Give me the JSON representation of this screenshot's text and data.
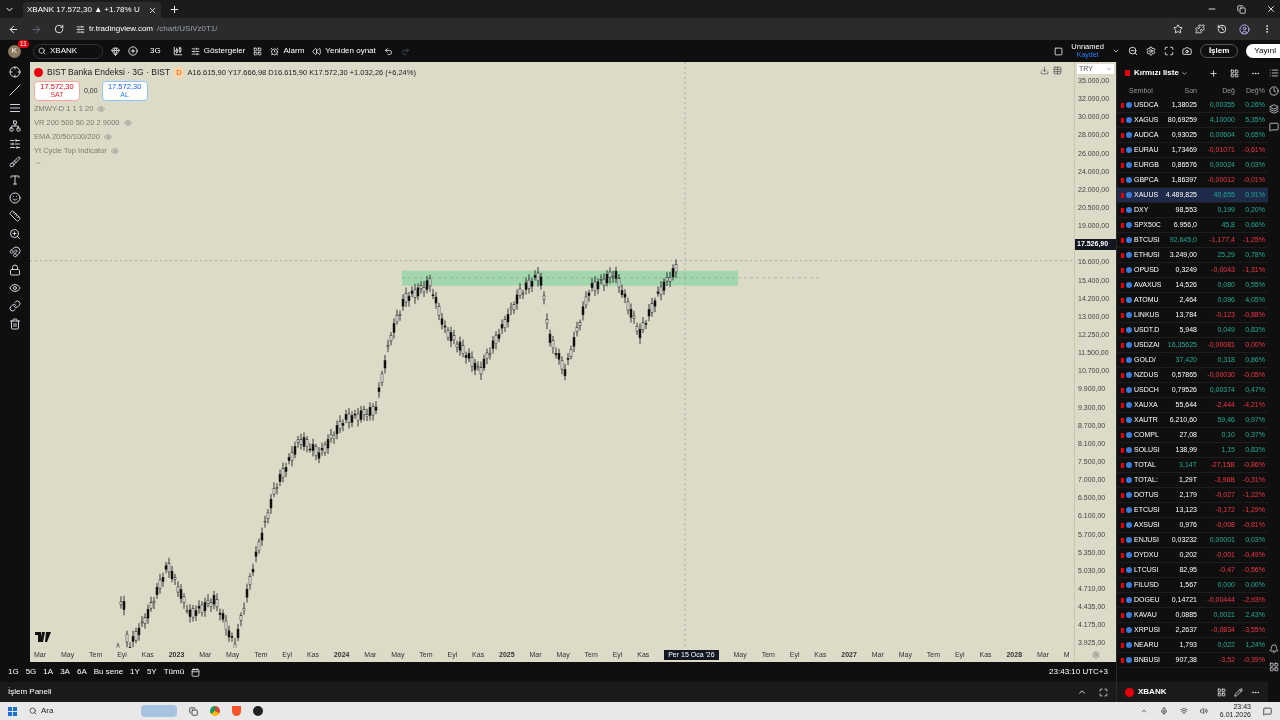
{
  "browser": {
    "tab_title": "XBANK 17.572,30 ▲ +1.78% U",
    "url_domain": "tr.tradingview.com",
    "url_path": "/chart/USiVz0T1/"
  },
  "toolbar": {
    "avatar": "K",
    "badge": "11",
    "symbol": "XBANK",
    "interval": "3G",
    "indicators": "Göstergeler",
    "alarm": "Alarm",
    "replay": "Yeniden oynat",
    "layout_name": "Unnamed",
    "save": "Kaydet",
    "trade": "İşlem",
    "publish": "Yayınl"
  },
  "legend": {
    "title": "BIST Banka Endeksi · 3G · BIST",
    "badge": "D",
    "ohlc": "A16.615,90 Y17.666,98 D16.615,90 K17.572,30 +1.032,26 (+6,24%)",
    "sell_price": "17.572,30",
    "sell_label": "SAT",
    "spread": "0,00",
    "buy_price": "17.572,30",
    "buy_label": "AL",
    "indicators": [
      "ZMWY-D 1 1 1 20",
      "VR 200 500 50 20 2 9000",
      "EMA 20/50/100/200",
      "Yt Cycle Top Indicator"
    ]
  },
  "price_axis": {
    "currency": "TRY",
    "labels": [
      {
        "text": "35.000,00",
        "kind": "tick"
      },
      {
        "text": "32.000,00",
        "kind": "tick"
      },
      {
        "text": "30.000,00",
        "kind": "tick"
      },
      {
        "text": "28.000,00",
        "kind": "tick"
      },
      {
        "text": "26.000,00",
        "kind": "tick"
      },
      {
        "text": "24.000,00",
        "kind": "tick"
      },
      {
        "text": "22.000,00",
        "kind": "tick"
      },
      {
        "text": "20.500,00",
        "kind": "tick"
      },
      {
        "text": "19.000,00",
        "kind": "tick"
      },
      {
        "text": "17.526,90",
        "kind": "crosshair"
      },
      {
        "text": "16.600,00",
        "kind": "tick"
      },
      {
        "text": "15.400,00",
        "kind": "tick"
      },
      {
        "text": "14.200,00",
        "kind": "tick"
      },
      {
        "text": "13.000,00",
        "kind": "tick"
      },
      {
        "text": "12.250,00",
        "kind": "tick"
      },
      {
        "text": "11.500,00",
        "kind": "tick"
      },
      {
        "text": "10.700,00",
        "kind": "tick"
      },
      {
        "text": "9.900,00",
        "kind": "tick"
      },
      {
        "text": "9.300,00",
        "kind": "tick"
      },
      {
        "text": "8.700,00",
        "kind": "tick"
      },
      {
        "text": "8.100,00",
        "kind": "tick"
      },
      {
        "text": "7.500,00",
        "kind": "tick"
      },
      {
        "text": "7.000,00",
        "kind": "tick"
      },
      {
        "text": "6.500,00",
        "kind": "tick"
      },
      {
        "text": "6.100,00",
        "kind": "tick"
      },
      {
        "text": "5.700,00",
        "kind": "tick"
      },
      {
        "text": "5.350,00",
        "kind": "tick"
      },
      {
        "text": "5.030,00",
        "kind": "tick"
      },
      {
        "text": "4.710,00",
        "kind": "tick"
      },
      {
        "text": "4.435,00",
        "kind": "tick"
      },
      {
        "text": "4.175,00",
        "kind": "tick"
      },
      {
        "text": "3.925,00",
        "kind": "tick"
      }
    ]
  },
  "time_axis": [
    {
      "text": "Mar",
      "kind": "tick"
    },
    {
      "text": "May",
      "kind": "tick"
    },
    {
      "text": "Tem",
      "kind": "tick"
    },
    {
      "text": "Eyl",
      "kind": "tick"
    },
    {
      "text": "Kas",
      "kind": "tick"
    },
    {
      "text": "2023",
      "kind": "year"
    },
    {
      "text": "Mar",
      "kind": "tick"
    },
    {
      "text": "May",
      "kind": "tick"
    },
    {
      "text": "Tem",
      "kind": "tick"
    },
    {
      "text": "Eyl",
      "kind": "tick"
    },
    {
      "text": "Kas",
      "kind": "tick"
    },
    {
      "text": "2024",
      "kind": "year"
    },
    {
      "text": "Mar",
      "kind": "tick"
    },
    {
      "text": "May",
      "kind": "tick"
    },
    {
      "text": "Tem",
      "kind": "tick"
    },
    {
      "text": "Eyl",
      "kind": "tick"
    },
    {
      "text": "Kas",
      "kind": "tick"
    },
    {
      "text": "2025",
      "kind": "year"
    },
    {
      "text": "Mar",
      "kind": "tick"
    },
    {
      "text": "May",
      "kind": "tick"
    },
    {
      "text": "Tem",
      "kind": "tick"
    },
    {
      "text": "Eyl",
      "kind": "tick"
    },
    {
      "text": "Kas",
      "kind": "tick"
    },
    {
      "text": "Per 15 Oca '26",
      "kind": "crosshair"
    },
    {
      "text": "May",
      "kind": "tick"
    },
    {
      "text": "Tem",
      "kind": "tick"
    },
    {
      "text": "Eyl",
      "kind": "tick"
    },
    {
      "text": "Kas",
      "kind": "tick"
    },
    {
      "text": "2027",
      "kind": "year"
    },
    {
      "text": "Mar",
      "kind": "tick"
    },
    {
      "text": "May",
      "kind": "tick"
    },
    {
      "text": "Tem",
      "kind": "tick"
    },
    {
      "text": "Eyl",
      "kind": "tick"
    },
    {
      "text": "Kas",
      "kind": "tick"
    },
    {
      "text": "2028",
      "kind": "year"
    },
    {
      "text": "Mar",
      "kind": "tick"
    },
    {
      "text": "M",
      "kind": "tick"
    }
  ],
  "ranges": [
    "1G",
    "5G",
    "1A",
    "3A",
    "6A",
    "Bu sene",
    "1Y",
    "5Y",
    "Tümü"
  ],
  "clock": "23:43:10 UTC+3",
  "bottom_panel": "İşlem Paneli",
  "watchlist": {
    "title": "Kırmızı liste",
    "columns": [
      "Sembol",
      "Son",
      "Değ",
      "Değ%"
    ],
    "footer_symbol": "XBANK",
    "rows": [
      {
        "symbol": "USDCA",
        "last": "1,38025",
        "change": "0,00355",
        "change_pct": "0,26%",
        "up": true,
        "last_up": false,
        "selected": false
      },
      {
        "symbol": "XAGUS",
        "last": "80,69259",
        "change": "4,10000",
        "change_pct": "5,35%",
        "up": true,
        "last_up": false,
        "selected": false
      },
      {
        "symbol": "AUDCA",
        "last": "0,93025",
        "change": "0,00604",
        "change_pct": "0,65%",
        "up": true,
        "last_up": false,
        "selected": false
      },
      {
        "symbol": "EURAU",
        "last": "1,73469",
        "change": "-0,01071",
        "change_pct": "-0,61%",
        "up": false,
        "last_up": false,
        "selected": false
      },
      {
        "symbol": "EURGB",
        "last": "0,86576",
        "change": "0,00024",
        "change_pct": "0,03%",
        "up": true,
        "last_up": false,
        "selected": false
      },
      {
        "symbol": "GBPCA",
        "last": "1,86397",
        "change": "-0,00012",
        "change_pct": "-0,01%",
        "up": false,
        "last_up": false,
        "selected": false
      },
      {
        "symbol": "XAUUS",
        "last": "4.489,825",
        "change": "40,655",
        "change_pct": "0,91%",
        "up": true,
        "last_up": false,
        "selected": true
      },
      {
        "symbol": "DXY",
        "last": "98,553",
        "change": "0,199",
        "change_pct": "0,20%",
        "up": true,
        "last_up": false,
        "selected": false
      },
      {
        "symbol": "SPX50C",
        "last": "6.956,0",
        "change": "45,8",
        "change_pct": "0,66%",
        "up": true,
        "last_up": false,
        "selected": false
      },
      {
        "symbol": "BTCUSI",
        "last": "92.645,0",
        "change": "-1.177,4",
        "change_pct": "-1,25%",
        "up": false,
        "last_up": true,
        "selected": false
      },
      {
        "symbol": "ETHUSI",
        "last": "3.249,00",
        "change": "25,29",
        "change_pct": "0,78%",
        "up": true,
        "last_up": false,
        "selected": false
      },
      {
        "symbol": "OPUSD",
        "last": "0,3249",
        "change": "-0,0043",
        "change_pct": "-1,31%",
        "up": false,
        "last_up": false,
        "selected": false
      },
      {
        "symbol": "AVAXUS",
        "last": "14,526",
        "change": "0,080",
        "change_pct": "0,55%",
        "up": true,
        "last_up": false,
        "selected": false
      },
      {
        "symbol": "ATOMU",
        "last": "2,464",
        "change": "0,096",
        "change_pct": "4,05%",
        "up": true,
        "last_up": false,
        "selected": false
      },
      {
        "symbol": "LINKUS",
        "last": "13,784",
        "change": "-0,123",
        "change_pct": "-0,88%",
        "up": false,
        "last_up": false,
        "selected": false
      },
      {
        "symbol": "USDT.D",
        "last": "5,948",
        "change": "0,049",
        "change_pct": "0,83%",
        "up": true,
        "last_up": false,
        "selected": false
      },
      {
        "symbol": "USDZAI",
        "last": "16,35625",
        "change": "-0,00081",
        "change_pct": "0,00%",
        "up": false,
        "last_up": true,
        "selected": false
      },
      {
        "symbol": "GOLD/",
        "last": "37,420",
        "change": "0,318",
        "change_pct": "0,86%",
        "up": true,
        "last_up": true,
        "selected": false
      },
      {
        "symbol": "NZDUS",
        "last": "0,57865",
        "change": "-0,00030",
        "change_pct": "-0,05%",
        "up": false,
        "last_up": false,
        "selected": false
      },
      {
        "symbol": "USDCH",
        "last": "0,79526",
        "change": "0,00374",
        "change_pct": "0,47%",
        "up": true,
        "last_up": false,
        "selected": false
      },
      {
        "symbol": "XAUXA",
        "last": "55,644",
        "change": "-2,444",
        "change_pct": "-4,21%",
        "up": false,
        "last_up": false,
        "selected": false
      },
      {
        "symbol": "XAUTR",
        "last": "6.210,60",
        "change": "59,46",
        "change_pct": "0,97%",
        "up": true,
        "last_up": false,
        "selected": false
      },
      {
        "symbol": "COMPL",
        "last": "27,08",
        "change": "0,10",
        "change_pct": "0,37%",
        "up": true,
        "last_up": false,
        "selected": false
      },
      {
        "symbol": "SOLUSI",
        "last": "138,99",
        "change": "1,15",
        "change_pct": "0,83%",
        "up": true,
        "last_up": false,
        "selected": false
      },
      {
        "symbol": "TOTAL",
        "last": "3,14T",
        "change": "-27,15B",
        "change_pct": "-0,86%",
        "up": false,
        "last_up": true,
        "selected": false
      },
      {
        "symbol": "TOTAL:",
        "last": "1,29T",
        "change": "-3,96B",
        "change_pct": "-0,31%",
        "up": false,
        "last_up": false,
        "selected": false
      },
      {
        "symbol": "DOTUS",
        "last": "2,179",
        "change": "-0,027",
        "change_pct": "-1,22%",
        "up": false,
        "last_up": false,
        "selected": false
      },
      {
        "symbol": "ETCUSI",
        "last": "13,123",
        "change": "-0,172",
        "change_pct": "-1,29%",
        "up": false,
        "last_up": false,
        "selected": false
      },
      {
        "symbol": "AXSUSI",
        "last": "0,976",
        "change": "-0,008",
        "change_pct": "-0,81%",
        "up": false,
        "last_up": false,
        "selected": false
      },
      {
        "symbol": "ENJUSI",
        "last": "0,03232",
        "change": "0,00001",
        "change_pct": "0,03%",
        "up": true,
        "last_up": false,
        "selected": false
      },
      {
        "symbol": "DYDXU",
        "last": "0,202",
        "change": "-0,001",
        "change_pct": "-0,49%",
        "up": false,
        "last_up": false,
        "selected": false
      },
      {
        "symbol": "LTCUSI",
        "last": "82,95",
        "change": "-0,47",
        "change_pct": "-0,56%",
        "up": false,
        "last_up": false,
        "selected": false
      },
      {
        "symbol": "FILUSD",
        "last": "1,567",
        "change": "0,000",
        "change_pct": "0,00%",
        "up": true,
        "last_up": false,
        "selected": false
      },
      {
        "symbol": "DOGEU",
        "last": "0,14721",
        "change": "-0,00444",
        "change_pct": "-2,93%",
        "up": false,
        "last_up": false,
        "selected": false
      },
      {
        "symbol": "KAVAU",
        "last": "0,0885",
        "change": "0,0021",
        "change_pct": "2,43%",
        "up": true,
        "last_up": false,
        "selected": false
      },
      {
        "symbol": "XRPUSI",
        "last": "2,2637",
        "change": "-0,0834",
        "change_pct": "-3,55%",
        "up": false,
        "last_up": false,
        "selected": false
      },
      {
        "symbol": "NEARU",
        "last": "1,793",
        "change": "0,022",
        "change_pct": "1,24%",
        "up": true,
        "last_up": false,
        "selected": false
      },
      {
        "symbol": "BNBUSI",
        "last": "907,38",
        "change": "-3,52",
        "change_pct": "-0,39%",
        "up": false,
        "last_up": false,
        "selected": false
      }
    ]
  },
  "taskbar": {
    "search": "Ara",
    "time": "23:43",
    "date": "6.01.2026"
  }
}
